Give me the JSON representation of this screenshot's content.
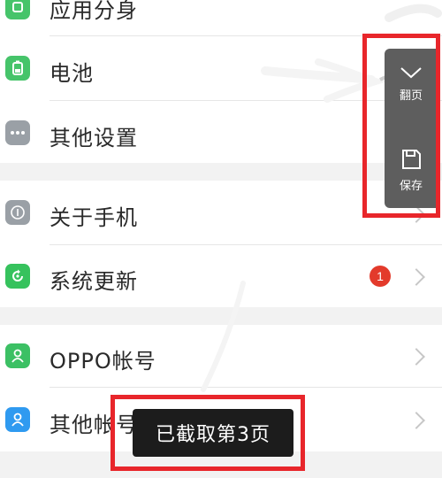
{
  "rows": [
    {
      "label": "应用分身"
    },
    {
      "label": "电池"
    },
    {
      "label": "其他设置"
    },
    {
      "label": "关于手机"
    },
    {
      "label": "系统更新",
      "badge": "1"
    },
    {
      "label": "OPPO帐号"
    },
    {
      "label": "其他帐号"
    }
  ],
  "toolbar": {
    "page_turn_label": "翻页",
    "save_label": "保存"
  },
  "toast": {
    "text": "已截取第3页"
  },
  "colors": {
    "app_clone_icon": "#46c46a",
    "battery_icon": "#46c46a",
    "other_settings_icon": "#9aa0a6",
    "about_icon": "#9aa0a6",
    "update_icon": "#36c25d",
    "oppo_account_icon": "#3cc064",
    "other_account_icon": "#2f9af0",
    "highlight": "#e8262b",
    "badge": "#e33a2b"
  }
}
